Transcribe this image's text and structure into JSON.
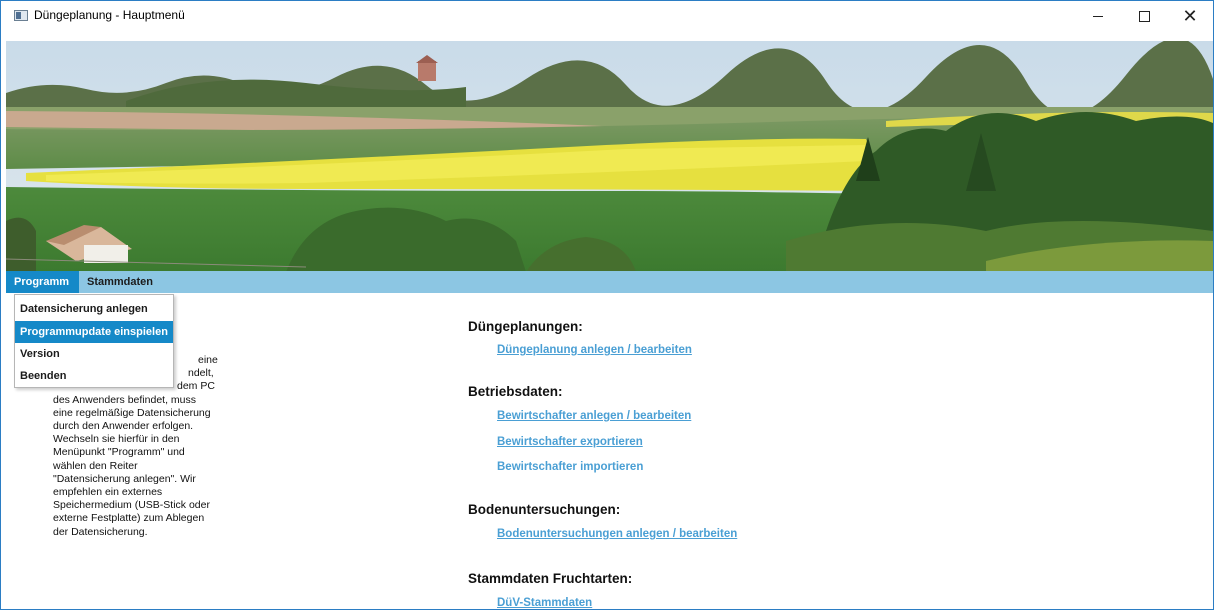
{
  "window": {
    "title": "Düngeplanung - Hauptmenü",
    "controls": {
      "minimize": "—",
      "maximize": "☐",
      "close": "✕"
    }
  },
  "menubar": {
    "items": [
      "Programm",
      "Stammdaten"
    ],
    "active": "Programm"
  },
  "dropdown": {
    "items": [
      "Datensicherung anlegen",
      "Programmupdate einspielen",
      "Version",
      "Beenden"
    ],
    "highlighted": "Programmupdate einspielen"
  },
  "info": {
    "lines": [
      "eine",
      "ndelt,",
      "dem PC",
      "des Anwenders befindet, muss",
      "eine regelmäßige Datensicherung",
      "durch den Anwender erfolgen.",
      "Wechseln sie hierfür in den",
      "Menüpunkt \"Programm\" und",
      "wählen den Reiter",
      "\"Datensicherung anlegen\". Wir",
      "empfehlen ein externes",
      "Speichermedium (USB-Stick oder",
      "externe Festplatte) zum Ablegen",
      "der Datensicherung."
    ]
  },
  "sections": {
    "duengeplanungen": {
      "title": "Düngeplanungen:",
      "links": [
        "Düngeplanung anlegen / bearbeiten"
      ]
    },
    "betriebsdaten": {
      "title": "Betriebsdaten:",
      "links": [
        "Bewirtschafter anlegen / bearbeiten",
        "Bewirtschafter exportieren",
        "Bewirtschafter importieren"
      ]
    },
    "bodenuntersuchungen": {
      "title": "Bodenuntersuchungen:",
      "links": [
        "Bodenuntersuchungen anlegen / bearbeiten"
      ]
    },
    "stammdaten_fruchtarten": {
      "title": "Stammdaten Fruchtarten:",
      "links": [
        "DüV-Stammdaten"
      ]
    }
  },
  "colors": {
    "menubar": "#8cc6e3",
    "accent": "#1589c8",
    "link": "#4a9fd4",
    "window_border": "#2b7dc4"
  },
  "icons": {
    "app": "app-window-icon",
    "minimize": "minimize-icon",
    "maximize": "maximize-icon",
    "close": "close-icon"
  }
}
